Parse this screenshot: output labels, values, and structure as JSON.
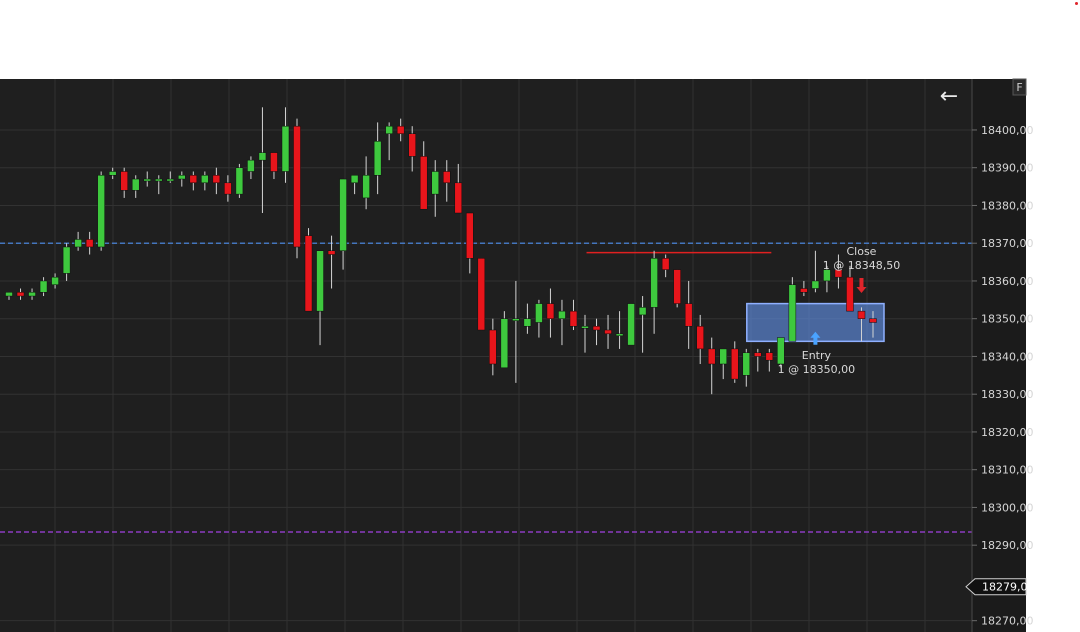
{
  "chart_data": {
    "type": "candlestick",
    "y_ticks": [
      "18400,00",
      "18390,00",
      "18380,00",
      "18370,00",
      "18360,00",
      "18350,00",
      "18340,00",
      "18330,00",
      "18320,00",
      "18310,00",
      "18300,00",
      "18290,00",
      "18279,00",
      "18270,00"
    ],
    "y_tick_values": [
      18400,
      18390,
      18380,
      18370,
      18360,
      18350,
      18340,
      18330,
      18320,
      18310,
      18300,
      18290,
      18279,
      18270
    ],
    "ylim": [
      18267,
      18413.5
    ],
    "last_price": 18279,
    "last_price_label": "18279,00",
    "horizontal_lines": [
      {
        "value": 18370,
        "color": "#4d8ff0"
      },
      {
        "value": 18293.5,
        "color": "#a040e0"
      }
    ],
    "resistance_line": {
      "from_index": 51,
      "to_index": 66,
      "value": 18367.5,
      "color": "#e02020"
    },
    "trade_box": {
      "from_index": 65,
      "to_index": 75,
      "high": 18354,
      "low": 18344,
      "fill": "#5a84d0",
      "stroke": "#8fb0ff"
    },
    "entry": {
      "index": 70,
      "label": "Entry",
      "detail": "1 @ 18350,00",
      "price": 18350,
      "color": "#4aa3ff"
    },
    "close": {
      "index": 74,
      "label": "Close",
      "detail": "1 @ 18348,50",
      "price": 18348.5,
      "color": "#e0252b"
    },
    "colors": {
      "up": "#3ec93e",
      "down": "#e8151b",
      "wick": "#d4d4d4",
      "background": "#1f1f1f",
      "grid": "#323232",
      "axis_bg": "#1b1b1b"
    },
    "candles": [
      [
        18356,
        18357,
        18355,
        18357
      ],
      [
        18357,
        18358,
        18355,
        18356
      ],
      [
        18356,
        18358,
        18355,
        18357
      ],
      [
        18357,
        18361,
        18356,
        18360
      ],
      [
        18359,
        18362,
        18358,
        18361
      ],
      [
        18362,
        18370,
        18360,
        18369
      ],
      [
        18369,
        18373,
        18368,
        18371
      ],
      [
        18371,
        18373,
        18367,
        18369
      ],
      [
        18369,
        18389,
        18368,
        18388
      ],
      [
        18388,
        18390,
        18387,
        18389
      ],
      [
        18389,
        18390,
        18382,
        18384
      ],
      [
        18384,
        18388,
        18382,
        18387
      ],
      [
        18387,
        18389,
        18385,
        18387
      ],
      [
        18387,
        18388,
        18383,
        18387
      ],
      [
        18387,
        18389,
        18386,
        18387
      ],
      [
        18387,
        18389,
        18385,
        18388
      ],
      [
        18388,
        18389,
        18384,
        18386
      ],
      [
        18386,
        18389,
        18384,
        18388
      ],
      [
        18388,
        18390,
        18383,
        18386
      ],
      [
        18386,
        18388,
        18381,
        18383
      ],
      [
        18383,
        18391,
        18382,
        18390
      ],
      [
        18389,
        18393,
        18387,
        18392
      ],
      [
        18392,
        18406,
        18378,
        18394
      ],
      [
        18394,
        18394,
        18387,
        18389
      ],
      [
        18389,
        18406,
        18386,
        18401
      ],
      [
        18401,
        18403,
        18366,
        18369
      ],
      [
        18372,
        18374,
        18356,
        18352
      ],
      [
        18352,
        18368,
        18343,
        18368
      ],
      [
        18368,
        18372,
        18358,
        18367
      ],
      [
        18368,
        18387,
        18363,
        18387
      ],
      [
        18386,
        18388,
        18383,
        18388
      ],
      [
        18382,
        18393,
        18379,
        18388
      ],
      [
        18388,
        18402,
        18383,
        18397
      ],
      [
        18399,
        18402,
        18392,
        18401
      ],
      [
        18401,
        18403,
        18397,
        18399
      ],
      [
        18399,
        18401,
        18389,
        18393
      ],
      [
        18393,
        18397,
        18380,
        18379
      ],
      [
        18383,
        18392,
        18377,
        18389
      ],
      [
        18389,
        18392,
        18381,
        18386
      ],
      [
        18386,
        18391,
        18378,
        18378
      ],
      [
        18378,
        18378,
        18362,
        18366
      ],
      [
        18366,
        18366,
        18347,
        18347
      ],
      [
        18347,
        18350,
        18335,
        18338
      ],
      [
        18337,
        18352,
        18337,
        18350
      ],
      [
        18350,
        18360,
        18333,
        18350
      ],
      [
        18348,
        18354,
        18346,
        18350
      ],
      [
        18349,
        18355,
        18345,
        18354
      ],
      [
        18354,
        18358,
        18345,
        18350
      ],
      [
        18350,
        18355,
        18343,
        18352
      ],
      [
        18352,
        18355,
        18347,
        18348
      ],
      [
        18348,
        18351,
        18341,
        18348
      ],
      [
        18348,
        18350,
        18343,
        18347
      ],
      [
        18347,
        18351,
        18342,
        18346
      ],
      [
        18346,
        18352,
        18342,
        18346
      ],
      [
        18343,
        18354,
        18344,
        18354
      ],
      [
        18351,
        18356,
        18341,
        18353
      ],
      [
        18353,
        18368,
        18346,
        18366
      ],
      [
        18366,
        18367,
        18361,
        18363
      ],
      [
        18363,
        18363,
        18353,
        18354
      ],
      [
        18354,
        18360,
        18342,
        18348
      ],
      [
        18348,
        18351,
        18338,
        18342
      ],
      [
        18342,
        18345,
        18330,
        18338
      ],
      [
        18338,
        18341,
        18334,
        18342
      ],
      [
        18342,
        18344,
        18333,
        18334
      ],
      [
        18335,
        18342,
        18332,
        18341
      ],
      [
        18341,
        18342,
        18336,
        18340
      ],
      [
        18341,
        18342,
        18336,
        18339
      ],
      [
        18338,
        18345,
        18337,
        18345
      ],
      [
        18344,
        18361,
        18344,
        18359
      ],
      [
        18358,
        18360,
        18356,
        18357
      ],
      [
        18358,
        18368,
        18357,
        18360
      ],
      [
        18360,
        18364,
        18357,
        18363
      ],
      [
        18363,
        18367,
        18358,
        18361
      ],
      [
        18361,
        18364,
        18356,
        18352
      ],
      [
        18352,
        18353,
        18344,
        18350
      ],
      [
        18350,
        18352,
        18345,
        18349
      ]
    ]
  },
  "toolbar": {
    "back_label": "←",
    "corner_label": "F"
  }
}
